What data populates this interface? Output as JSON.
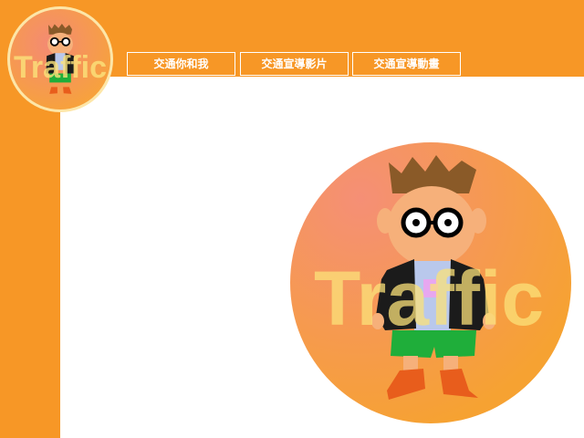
{
  "nav": {
    "items": [
      {
        "label": "交通你和我"
      },
      {
        "label": "交通宣導影片"
      },
      {
        "label": "交通宣導動畫"
      }
    ]
  },
  "logo": {
    "word": "Traffic"
  },
  "hero": {
    "word": "Traffic"
  },
  "colors": {
    "accent": "#f79726",
    "background": "#ffffff",
    "nav_text": "#ffffff"
  }
}
